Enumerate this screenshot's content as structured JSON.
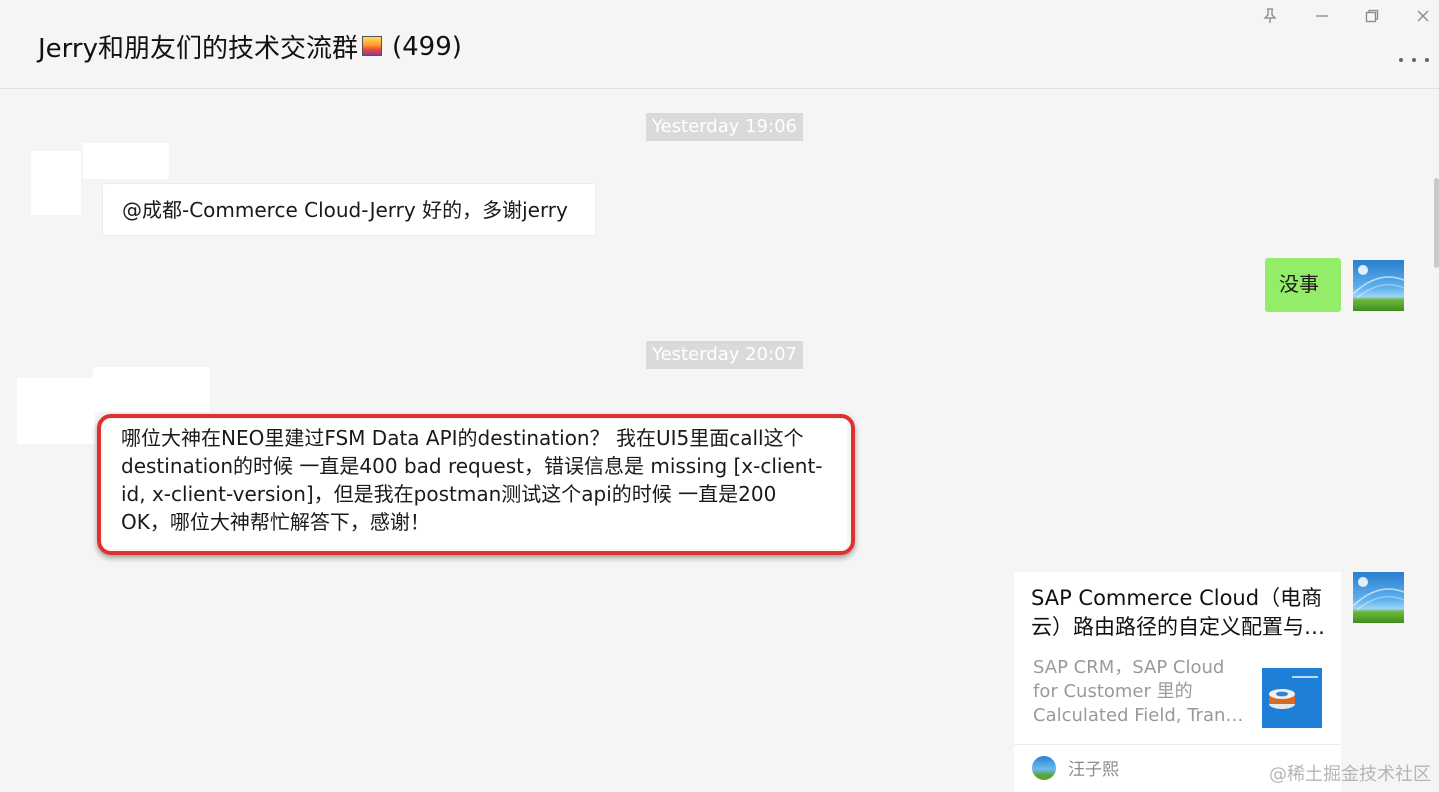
{
  "header": {
    "title": "Jerry和朋友们的技术交流群",
    "member_count": "(499)"
  },
  "window_controls": {
    "pin_icon": "pin-icon",
    "minimize_icon": "minimize-icon",
    "maximize_icon": "maximize-icon",
    "close_icon": "close-icon"
  },
  "messages": {
    "time1": "Yesterday 19:06",
    "msg1_text": "@成都-Commerce Cloud-Jerry 好的，多谢jerry",
    "msg2_text": "没事",
    "time2": "Yesterday 20:07",
    "msg3_lines": [
      "哪位大神在NEO里建过FSM Data API的destination？ 我在UI5里面call这个",
      "destination的时候 一直是400 bad request，错误信息是 missing [x-client-",
      "id, x-client-version]，但是我在postman测试这个api的时候 一直是200",
      "OK，哪位大神帮忙解答下，感谢！"
    ]
  },
  "link_card": {
    "title": "SAP Commerce Cloud（电商云）路由路径的自定义配置与实现",
    "desc_lines": [
      "SAP CRM，SAP Cloud",
      "for Customer 里的",
      "Calculated Field, Transient Field"
    ],
    "source_name": "汪子熙"
  },
  "watermark": "@稀土掘金技术社区",
  "colors": {
    "self_bubble": "#95ec69",
    "highlight": "#e03030",
    "background": "#f5f5f5"
  }
}
